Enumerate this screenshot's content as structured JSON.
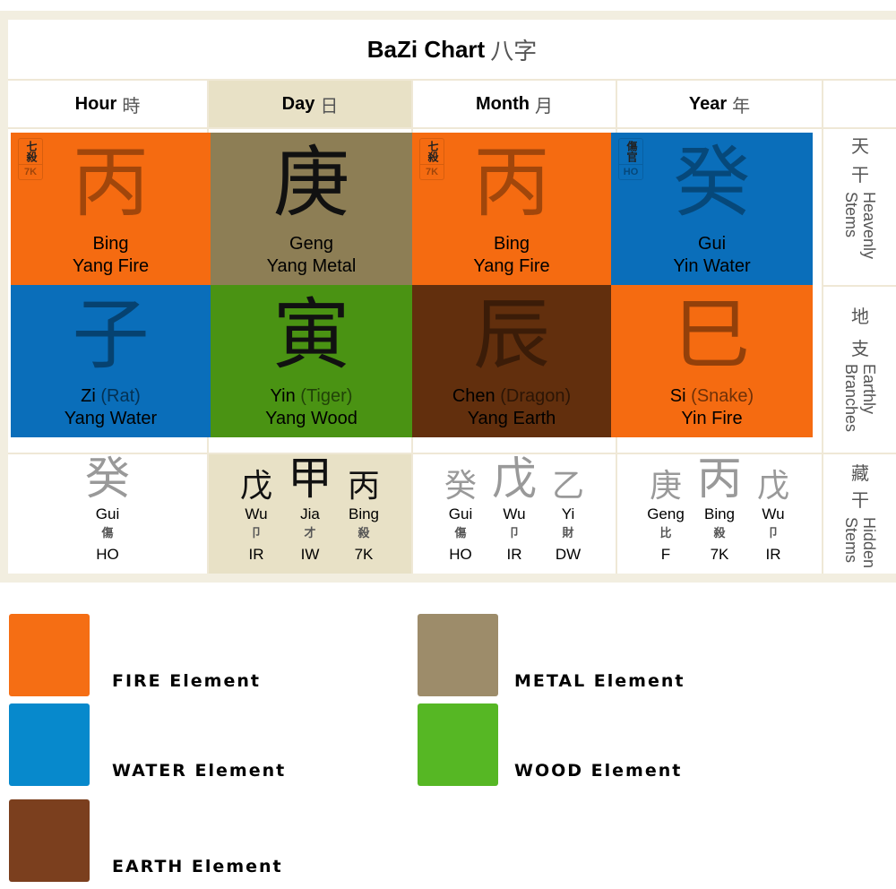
{
  "title": {
    "text": "BaZi Chart",
    "cjk": "八字"
  },
  "columns": [
    {
      "label": "Hour",
      "cjk": "時"
    },
    {
      "label": "Day",
      "cjk": "日"
    },
    {
      "label": "Month",
      "cjk": "月"
    },
    {
      "label": "Year",
      "cjk": "年"
    }
  ],
  "row_labels": {
    "heavenly": {
      "cjk1": "天",
      "cjk2": "干",
      "en1": "Heavenly",
      "en2": "Stems"
    },
    "earthly": {
      "cjk1": "地",
      "cjk2": "支",
      "en1": "Earthly",
      "en2": "Branches"
    },
    "hidden": {
      "cjk1": "藏",
      "cjk2": "干",
      "en1": "Hidden",
      "en2": "Stems"
    }
  },
  "colors": {
    "fire": "#f56b11",
    "water": "#0a6eba",
    "earth": "#622f0d",
    "metal": "#8d7e55",
    "wood": "#4a9313",
    "day_bg": "#e8e1c6",
    "frame": "#f2eee0"
  },
  "stems": [
    {
      "char": "丙",
      "name": "Bing",
      "desc": "Yang Fire",
      "element": "fire",
      "badge": {
        "cjk": "七殺",
        "abbr": "7K"
      }
    },
    {
      "char": "庚",
      "name": "Geng",
      "desc": "Yang Metal",
      "element": "metal",
      "badge": null
    },
    {
      "char": "丙",
      "name": "Bing",
      "desc": "Yang Fire",
      "element": "fire",
      "badge": {
        "cjk": "七殺",
        "abbr": "7K"
      }
    },
    {
      "char": "癸",
      "name": "Gui",
      "desc": "Yin Water",
      "element": "water",
      "badge": {
        "cjk": "傷官",
        "abbr": "HO"
      }
    }
  ],
  "branches": [
    {
      "char": "子",
      "name": "Zi",
      "animal": "(Rat)",
      "desc": "Yang Water",
      "element": "water"
    },
    {
      "char": "寅",
      "name": "Yin",
      "animal": "(Tiger)",
      "desc": "Yang Wood",
      "element": "wood"
    },
    {
      "char": "辰",
      "name": "Chen",
      "animal": "(Dragon)",
      "desc": "Yang Earth",
      "element": "earth"
    },
    {
      "char": "巳",
      "name": "Si",
      "animal": "(Snake)",
      "desc": "Yin Fire",
      "element": "fire"
    }
  ],
  "hidden_stems": [
    [
      {
        "char": "癸",
        "name": "Gui",
        "god": "傷",
        "abbr": "HO"
      }
    ],
    [
      {
        "char": "戊",
        "name": "Wu",
        "god": "卩",
        "abbr": "IR"
      },
      {
        "char": "甲",
        "name": "Jia",
        "god": "才",
        "abbr": "IW"
      },
      {
        "char": "丙",
        "name": "Bing",
        "god": "殺",
        "abbr": "7K"
      }
    ],
    [
      {
        "char": "癸",
        "name": "Gui",
        "god": "傷",
        "abbr": "HO"
      },
      {
        "char": "戊",
        "name": "Wu",
        "god": "卩",
        "abbr": "IR"
      },
      {
        "char": "乙",
        "name": "Yi",
        "god": "財",
        "abbr": "DW"
      }
    ],
    [
      {
        "char": "庚",
        "name": "Geng",
        "god": "比",
        "abbr": "F"
      },
      {
        "char": "丙",
        "name": "Bing",
        "god": "殺",
        "abbr": "7K"
      },
      {
        "char": "戊",
        "name": "Wu",
        "god": "卩",
        "abbr": "IR"
      }
    ]
  ],
  "legend": [
    {
      "label": "FIRE Element",
      "color": "#f56e14"
    },
    {
      "label": "METAL Element",
      "color": "#9d8c6a"
    },
    {
      "label": "WATER Element",
      "color": "#0789cc"
    },
    {
      "label": "WOOD Element",
      "color": "#56b724"
    },
    {
      "label": "EARTH Element",
      "color": "#7b3f1e"
    }
  ]
}
